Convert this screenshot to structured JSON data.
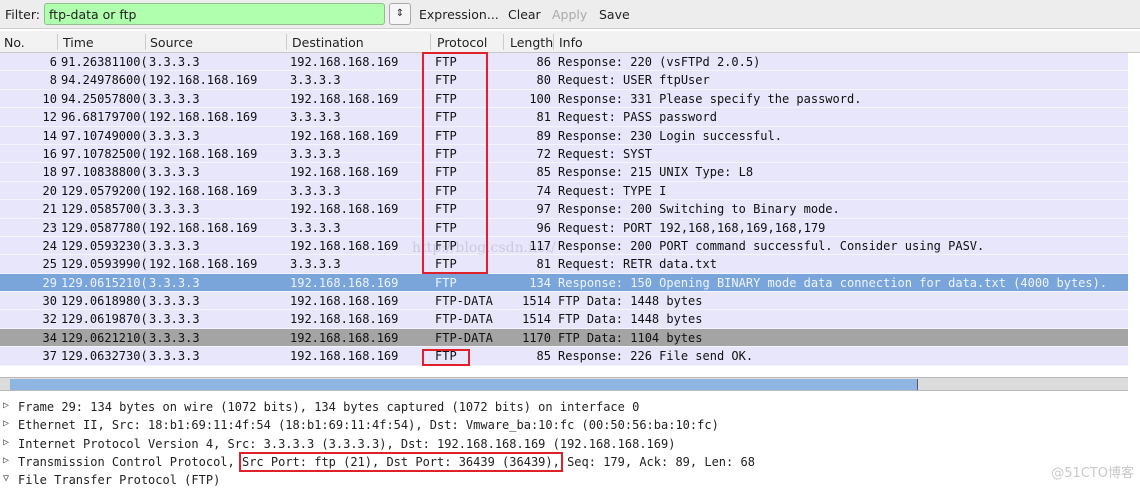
{
  "toolbar": {
    "filter_label": "Filter:",
    "filter_value": "ftp-data or ftp",
    "expression": "Expression...",
    "clear": "Clear",
    "apply": "Apply",
    "save": "Save"
  },
  "columns": [
    "No.",
    "Time",
    "Source",
    "Destination",
    "Protocol",
    "Length",
    "Info"
  ],
  "packets": [
    {
      "no": "6",
      "time": "91.26381100(",
      "src": "3.3.3.3",
      "dst": "192.168.168.169",
      "proto": "FTP",
      "len": "86",
      "info": "Response: 220 (vsFTPd 2.0.5)"
    },
    {
      "no": "8",
      "time": "94.24978600(",
      "src": "192.168.168.169",
      "dst": "3.3.3.3",
      "proto": "FTP",
      "len": "80",
      "info": "Request: USER ftpUser"
    },
    {
      "no": "10",
      "time": "94.25057800(",
      "src": "3.3.3.3",
      "dst": "192.168.168.169",
      "proto": "FTP",
      "len": "100",
      "info": "Response: 331 Please specify the password."
    },
    {
      "no": "12",
      "time": "96.68179700(",
      "src": "192.168.168.169",
      "dst": "3.3.3.3",
      "proto": "FTP",
      "len": "81",
      "info": "Request: PASS password"
    },
    {
      "no": "14",
      "time": "97.10749000(",
      "src": "3.3.3.3",
      "dst": "192.168.168.169",
      "proto": "FTP",
      "len": "89",
      "info": "Response: 230 Login successful."
    },
    {
      "no": "16",
      "time": "97.10782500(",
      "src": "192.168.168.169",
      "dst": "3.3.3.3",
      "proto": "FTP",
      "len": "72",
      "info": "Request: SYST"
    },
    {
      "no": "18",
      "time": "97.10838800(",
      "src": "3.3.3.3",
      "dst": "192.168.168.169",
      "proto": "FTP",
      "len": "85",
      "info": "Response: 215 UNIX Type: L8"
    },
    {
      "no": "20",
      "time": "129.0579200(",
      "src": "192.168.168.169",
      "dst": "3.3.3.3",
      "proto": "FTP",
      "len": "74",
      "info": "Request: TYPE I"
    },
    {
      "no": "21",
      "time": "129.0585700(",
      "src": "3.3.3.3",
      "dst": "192.168.168.169",
      "proto": "FTP",
      "len": "97",
      "info": "Response: 200 Switching to Binary mode."
    },
    {
      "no": "23",
      "time": "129.0587780(",
      "src": "192.168.168.169",
      "dst": "3.3.3.3",
      "proto": "FTP",
      "len": "96",
      "info": "Request: PORT 192,168,168,169,168,179"
    },
    {
      "no": "24",
      "time": "129.0593230(",
      "src": "3.3.3.3",
      "dst": "192.168.168.169",
      "proto": "FTP",
      "len": "117",
      "info": "Response: 200 PORT command successful. Consider using PASV."
    },
    {
      "no": "25",
      "time": "129.0593990(",
      "src": "192.168.168.169",
      "dst": "3.3.3.3",
      "proto": "FTP",
      "len": "81",
      "info": "Request: RETR data.txt"
    },
    {
      "no": "29",
      "time": "129.0615210(",
      "src": "3.3.3.3",
      "dst": "192.168.168.169",
      "proto": "FTP",
      "len": "134",
      "info": "Response: 150 Opening BINARY mode data connection for data.txt (4000 bytes).",
      "state": "selected"
    },
    {
      "no": "30",
      "time": "129.0618980(",
      "src": "3.3.3.3",
      "dst": "192.168.168.169",
      "proto": "FTP-DATA",
      "len": "1514",
      "info": "FTP Data: 1448 bytes"
    },
    {
      "no": "32",
      "time": "129.0619870(",
      "src": "3.3.3.3",
      "dst": "192.168.168.169",
      "proto": "FTP-DATA",
      "len": "1514",
      "info": "FTP Data: 1448 bytes"
    },
    {
      "no": "34",
      "time": "129.0621210(",
      "src": "3.3.3.3",
      "dst": "192.168.168.169",
      "proto": "FTP-DATA",
      "len": "1170",
      "info": "FTP Data: 1104 bytes",
      "state": "marked"
    },
    {
      "no": "37",
      "time": "129.0632730(",
      "src": "3.3.3.3",
      "dst": "192.168.168.169",
      "proto": "FTP",
      "len": "85",
      "info": "Response: 226 File send OK."
    }
  ],
  "details": [
    {
      "text": "Frame 29: 134 bytes on wire (1072 bits), 134 bytes captured (1072 bits) on interface 0",
      "expanded": false
    },
    {
      "text": "Ethernet II, Src: 18:b1:69:11:4f:54 (18:b1:69:11:4f:54), Dst: Vmware_ba:10:fc (00:50:56:ba:10:fc)",
      "expanded": false
    },
    {
      "text": "Internet Protocol Version 4, Src: 3.3.3.3 (3.3.3.3), Dst: 192.168.168.169 (192.168.168.169)",
      "expanded": false
    },
    {
      "pre": "Transmission Control Protocol, ",
      "hl": "Src Port: ftp (21), Dst Port: 36439 (36439),",
      "post": " Seq: 179, Ack: 89, Len: 68",
      "expanded": false
    },
    {
      "text": "File Transfer Protocol (FTP)",
      "expanded": true
    }
  ],
  "watermark": "@51CTO博客",
  "watermark2": "http://blog.csdn.net/",
  "colors": {
    "filter_valid": "#afffaf",
    "row": "#e7e6fb",
    "selected": "#79a5da",
    "marked": "#a4a4a4",
    "highlight_box": "#e0202a"
  }
}
